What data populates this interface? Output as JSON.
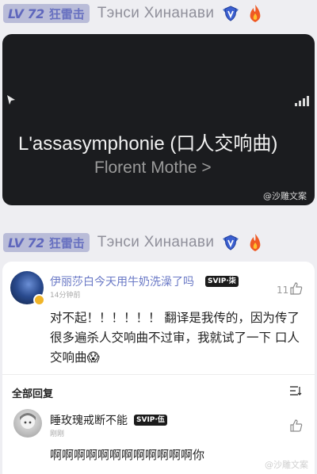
{
  "post_header": {
    "level": "LV 72",
    "level_title": "狂雷击",
    "username": "Тэнси Хинанави",
    "rank_icon": "shield-wings-icon",
    "fire_icon": "fire-icon"
  },
  "video": {
    "song_title": "L'assasymphonie (口人交响曲)",
    "artist": "Florent Mothe >",
    "watermark": "@沙雕文案"
  },
  "comment": {
    "author": "伊丽莎白今天用牛奶洗澡了吗",
    "vip_badge": "SVIP·柒",
    "time": "14分钟前",
    "likes": "11",
    "text": "对不起！！！！！！ 翻译是我传的，因为传了很多遍杀人交响曲不过审，我就试了一下 口人交响曲😱"
  },
  "replies_section": {
    "label": "全部回复",
    "sort_icon": "sort-icon"
  },
  "reply": {
    "author": "睡玫瑰戒断不能",
    "vip_badge": "SVIP·伍",
    "time": "刚刚",
    "text": "啊啊啊啊啊啊啊啊啊啊啊啊你"
  },
  "footer_watermark": "@沙雕文案",
  "colors": {
    "accent": "#5f67bd",
    "badge_bg": "#b9bcd8",
    "video_bg": "#1b1c1f",
    "name_link": "#6a79c6"
  }
}
